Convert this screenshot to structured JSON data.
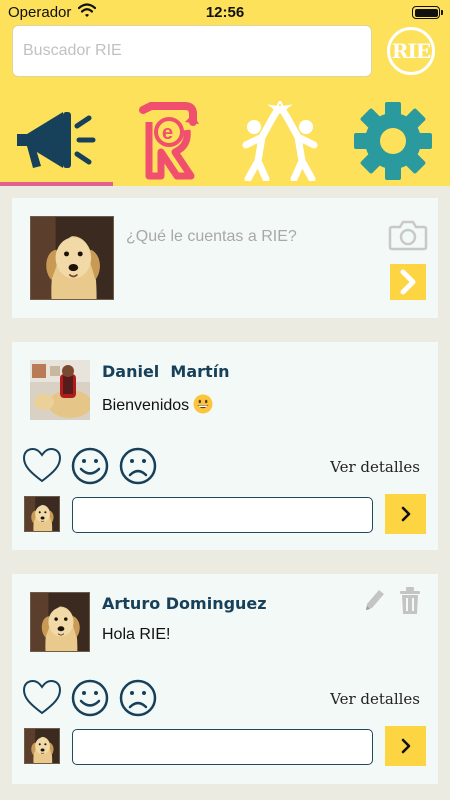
{
  "status": {
    "carrier": "Operador",
    "time": "12:56"
  },
  "search": {
    "placeholder": "Buscador RIE"
  },
  "logo": {
    "text": "RIE"
  },
  "tabs": [
    {
      "icon": "megaphone-icon",
      "active": true
    },
    {
      "icon": "rie-recycle-icon",
      "active": false
    },
    {
      "icon": "high-five-icon",
      "active": false
    },
    {
      "icon": "gear-icon",
      "active": false
    }
  ],
  "composer": {
    "placeholder": "¿Qué le cuentas a RIE?"
  },
  "posts": [
    {
      "author": "Daniel  Martín",
      "text": "Bienvenidos",
      "emoji": "grinning-face-icon",
      "details_label": "Ver detalles",
      "editable": false
    },
    {
      "author": "Arturo Dominguez",
      "text": "Hola RIE!",
      "details_label": "Ver detalles",
      "editable": true
    }
  ],
  "colors": {
    "header": "#fde15a",
    "accent_yellow": "#fdd442",
    "tab_indicator": "#e06090",
    "megaphone": "#17405a",
    "rie_icon": "#f0506e",
    "gear": "#2a9a9e",
    "name_text": "#17405a"
  }
}
